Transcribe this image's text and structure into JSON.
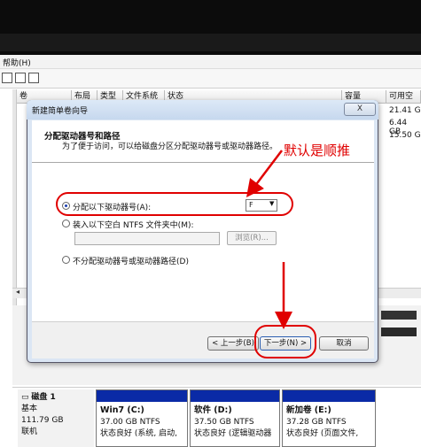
{
  "menubar": {
    "help_label": "帮助(H)"
  },
  "columns": {
    "volume": "卷",
    "layout": "布局",
    "type": "类型",
    "filesystem": "文件系统",
    "status": "状态",
    "capacity": "容量",
    "free": "可用空"
  },
  "capacity_rows": [
    "21.41 G",
    "6.44 GB",
    "15.50 G"
  ],
  "disk": {
    "name": "磁盘 1",
    "type": "基本",
    "size": "111.79 GB",
    "status": "联机",
    "partitions": [
      {
        "name": "Win7 (C:)",
        "size": "37.00 GB NTFS",
        "status": "状态良好 (系统, 启动,"
      },
      {
        "name": "软件 (D:)",
        "size": "37.50 GB NTFS",
        "status": "状态良好 (逻辑驱动器"
      },
      {
        "name": "新加卷 (E:)",
        "size": "37.28 GB NTFS",
        "status": "状态良好 (页面文件,"
      }
    ]
  },
  "wizard": {
    "title": "新建简单卷向导",
    "close_label": "X",
    "header_title": "分配驱动器号和路径",
    "header_desc": "为了便于访问，可以给磁盘分区分配驱动器号或驱动器路径。",
    "options": {
      "assign_letter": "分配以下驱动器号(A):",
      "mount_folder": "装入以下空白 NTFS 文件夹中(M):",
      "no_assign": "不分配驱动器号或驱动器路径(D)"
    },
    "drive_letter": "F",
    "browse_label": "浏览(R)...",
    "back_label": "< 上一步(B)",
    "next_label": "下一步(N) >",
    "cancel_label": "取消"
  },
  "annotations": {
    "default_note": "默认是顺推",
    "color": "#e00000"
  }
}
